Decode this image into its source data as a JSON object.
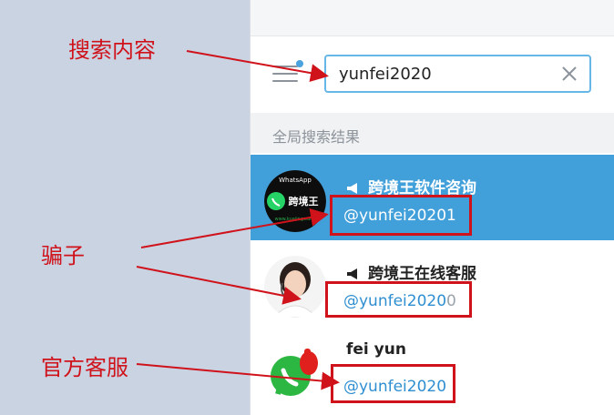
{
  "search": {
    "value": "yunfei2020"
  },
  "section": {
    "title": "全局搜索结果"
  },
  "results": [
    {
      "title": "跨境王软件咨询",
      "handle": "@yunfei20201",
      "avatar_label": "跨境王",
      "avatar_top": "WhatsApp",
      "avatar_url": "www.kuajingwang"
    },
    {
      "title": "跨境王在线客服",
      "handle": "@yunfei2020",
      "handle_tail": "0"
    },
    {
      "title": "fei yun",
      "handle": "@yunfei2020"
    }
  ],
  "annotations": {
    "search_content": "搜索内容",
    "scammer": "骗子",
    "official": "官方客服"
  },
  "colors": {
    "accent": "#419fd9",
    "annotation": "#d0121b",
    "link": "#2f8fd1"
  }
}
